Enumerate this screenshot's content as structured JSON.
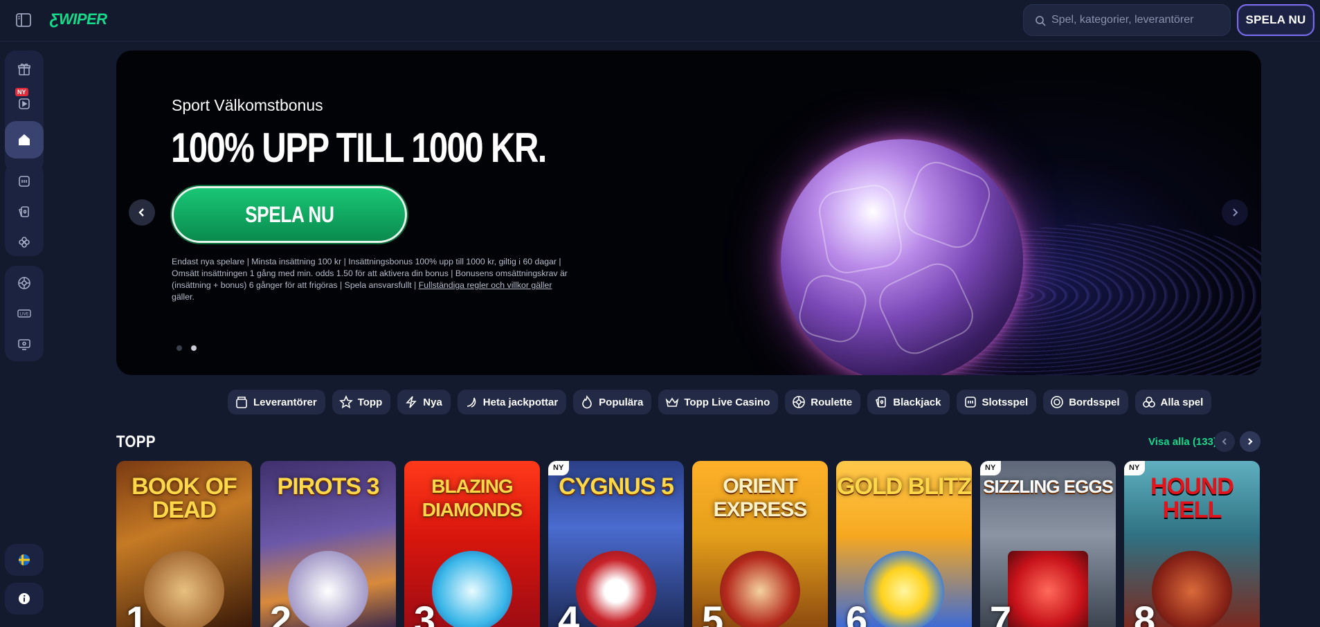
{
  "header": {
    "logo": "ƸWIPER",
    "search_placeholder": "Spel, kategorier, leverantörer",
    "play_button": "SPELA NU"
  },
  "sidebar": {
    "ny_badge": "NY",
    "top_group": [
      "gift-icon",
      "video-icon",
      "home-icon"
    ],
    "middle_group": [
      "slot-machine-icon",
      "cards-icon",
      "clover-icon"
    ],
    "bottom_group": [
      "roulette-icon",
      "live-icon",
      "tv-icon"
    ],
    "language_flag": "swedish-flag-icon",
    "info": "info-icon"
  },
  "banner": {
    "subtitle": "Sport Välkomstbonus",
    "headline": "100% UPP TILL 1000 KR.",
    "cta": "SPELA NU",
    "terms": "Endast nya spelare | Minsta insättning 100 kr | Insättningsbonus 100% upp till 1000 kr, giltig i 60 dagar | Omsätt insättningen 1 gång med min. odds 1.50 för att aktivera din bonus | Bonusens omsättningskrav är (insättning + bonus) 6 gånger för att frigöras | Spela ansvarsfullt |",
    "terms_link": "Fullständiga regler och villkor gäller",
    "terms_tail": "gäller.",
    "slides": 2,
    "active_slide": 2
  },
  "categories": [
    {
      "label": "Leverantörer",
      "icon": "providers-icon"
    },
    {
      "label": "Topp",
      "icon": "star-icon"
    },
    {
      "label": "Nya",
      "icon": "lightning-icon"
    },
    {
      "label": "Heta jackpottar",
      "icon": "hot-icon"
    },
    {
      "label": "Populära",
      "icon": "flame-icon"
    },
    {
      "label": "Topp Live Casino",
      "icon": "crown-icon"
    },
    {
      "label": "Roulette",
      "icon": "roulette-icon"
    },
    {
      "label": "Blackjack",
      "icon": "cards-icon"
    },
    {
      "label": "Slotsspel",
      "icon": "slot-machine-icon"
    },
    {
      "label": "Bordsspel",
      "icon": "chip-icon"
    },
    {
      "label": "Alla spel",
      "icon": "all-games-icon"
    }
  ],
  "top_section": {
    "title": "TOPP",
    "view_all": "Visa alla (133)",
    "games": [
      {
        "title": "BOOK OF DEAD",
        "rank": "1",
        "new": false
      },
      {
        "title": "PIROTS 3",
        "rank": "2",
        "new": false
      },
      {
        "title": "BLAZING DIAMONDS",
        "rank": "3",
        "new": false
      },
      {
        "title": "CYGNUS 5",
        "rank": "4",
        "new": true
      },
      {
        "title": "ORIENT EXPRESS",
        "rank": "5",
        "new": false
      },
      {
        "title": "GOLD BLITZ",
        "rank": "6",
        "new": false
      },
      {
        "title": "SIZZLING EGGS",
        "rank": "7",
        "new": true
      },
      {
        "title": "HOUND HELL",
        "rank": "8",
        "new": true
      }
    ],
    "new_badge": "NY"
  }
}
